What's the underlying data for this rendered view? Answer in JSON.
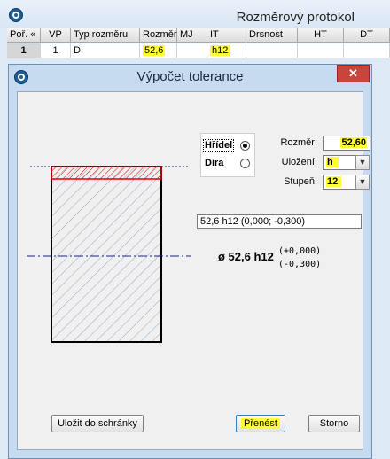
{
  "window": {
    "title": "Rozměrový protokol"
  },
  "grid": {
    "columns": [
      "Poř. «",
      "VP",
      "Typ rozměru",
      "Rozměr",
      "MJ",
      "IT",
      "Drsnost",
      "HT",
      "DT"
    ],
    "row": {
      "index": "1",
      "vp": "1",
      "type": "D",
      "rozmer": "52,6",
      "mj": "",
      "it": "h12",
      "drsnost": "",
      "ht": "",
      "dt": ""
    }
  },
  "dialog": {
    "title": "Výpočet tolerance",
    "close_icon": "close-icon",
    "radio": {
      "hridel": "Hřídel",
      "dira": "Díra",
      "selected": "hridel"
    },
    "rozmer": {
      "label": "Rozměr:",
      "value": "52,60"
    },
    "ulozeni": {
      "label": "Uložení:",
      "value": "h"
    },
    "stupen": {
      "label": "Stupeň:",
      "value": "12"
    },
    "summary": "52,6 h12 (0,000; -0,300)",
    "dimension": {
      "text": "ø 52,6 h12",
      "upper": "(+0,000)",
      "lower": "(-0,300)"
    },
    "buttons": {
      "clipboard": "Uložit do schránky",
      "transfer": "Přenést",
      "cancel": "Storno"
    }
  },
  "colors": {
    "highlight": "#ffff33",
    "tolerance_zone": "#e00000",
    "close_button": "#c9453a",
    "accent": "#1f5f95"
  }
}
